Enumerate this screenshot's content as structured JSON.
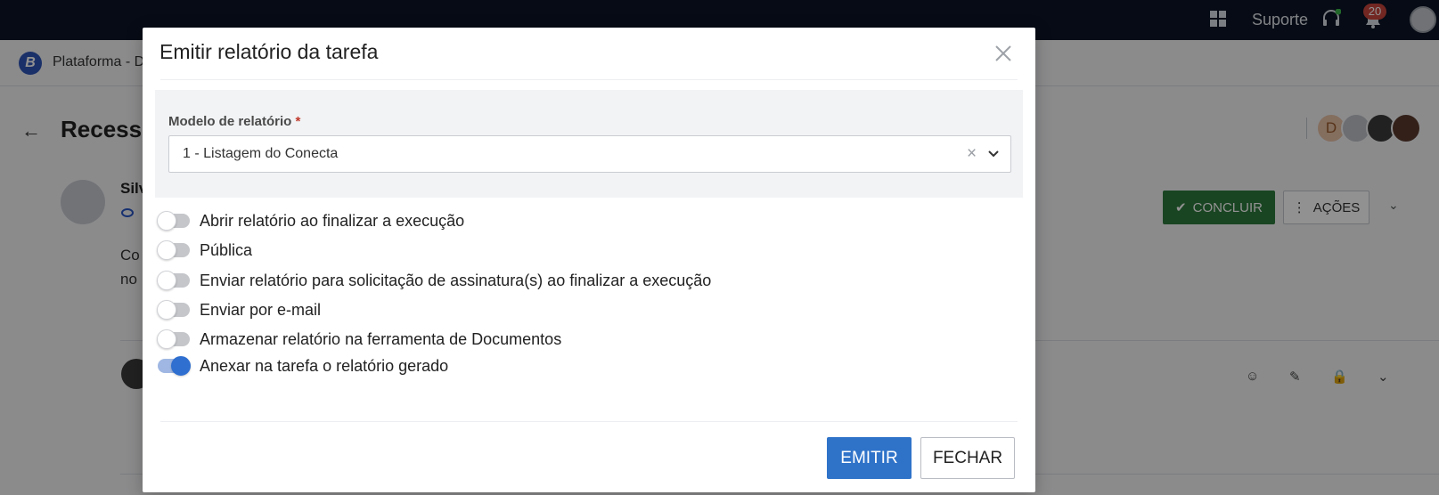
{
  "topbar": {
    "support_label": "Suporte",
    "notification_count": "20"
  },
  "breadcrumb": {
    "logo_letter": "B",
    "text": "Plataforma - D"
  },
  "page": {
    "title": "Recesso",
    "author": "Silv",
    "description_line1": "Co",
    "description_line2": "no",
    "participant_initial": "D",
    "concluir_label": "CONCLUIR",
    "acoes_label": "AÇÕES"
  },
  "modal": {
    "title": "Emitir relatório da tarefa",
    "field_label": "Modelo de relatório",
    "required_mark": "*",
    "select_value": "1 - Listagem do Conecta",
    "options": [
      {
        "label": "Abrir relatório ao finalizar a execução",
        "checked": false
      },
      {
        "label": "Pública",
        "checked": false
      },
      {
        "label": "Enviar relatório para solicitação de assinatura(s) ao finalizar a execução",
        "checked": false
      },
      {
        "label": "Enviar por e-mail",
        "checked": false
      },
      {
        "label": "Armazenar relatório na ferramenta de Documentos",
        "checked": false
      },
      {
        "label": "Anexar na tarefa o relatório gerado",
        "checked": true
      }
    ],
    "emit_button": "EMITIR",
    "close_button": "FECHAR"
  },
  "colors": {
    "topbar": "#0b1426",
    "primary": "#2f73c9",
    "success": "#2d7a3c",
    "badge": "#c9463d"
  }
}
